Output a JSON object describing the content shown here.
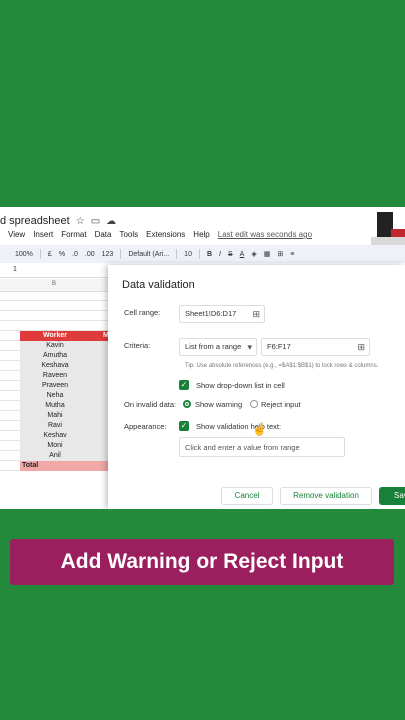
{
  "title": "d spreadsheet",
  "menu": [
    "View",
    "Insert",
    "Format",
    "Data",
    "Tools",
    "Extensions",
    "Help"
  ],
  "last_edit": "Last edit was seconds ago",
  "toolbar": {
    "zoom": "100%",
    "currency": "£",
    "percent": "%",
    "dec_less": ".0",
    "dec_more": ".00",
    "format": "123",
    "font": "Default (Ari...",
    "size": "10",
    "bold": "B"
  },
  "formula_ref": "1",
  "column_b": "B",
  "sheet": {
    "header": [
      "Worker",
      "M"
    ],
    "workers": [
      "Kavin",
      "Amutha",
      "Keshava",
      "Raveen",
      "Praveen",
      "Neha",
      "Mutha",
      "Mahi",
      "Ravi",
      "Keshav",
      "Moni",
      "Anil"
    ],
    "total": "Total"
  },
  "dialog": {
    "title": "Data validation",
    "cell_range_label": "Cell range:",
    "cell_range": "Sheet1!D6:D17",
    "criteria_label": "Criteria:",
    "criteria_type": "List from a range",
    "criteria_range": "F6:F17",
    "tip": "Tip: Use absolute references (e.g., =$A$1:$B$1) to lock rows & columns.",
    "dropdown_label": "Show drop-down list in cell",
    "invalid_label": "On invalid data:",
    "warning_label": "Show warning",
    "reject_label": "Reject input",
    "appearance_label": "Appearance:",
    "helptext_label": "Show validation help text:",
    "helptext_value": "Click and enter a value from range",
    "cancel": "Cancel",
    "remove": "Remove validation",
    "save": "Sav"
  },
  "banner": "Add Warning or Reject Input",
  "colors": {
    "background": "#238a3b",
    "accent": "#188038",
    "banner": "#9b1f5f",
    "header_red": "#e03b3b"
  }
}
